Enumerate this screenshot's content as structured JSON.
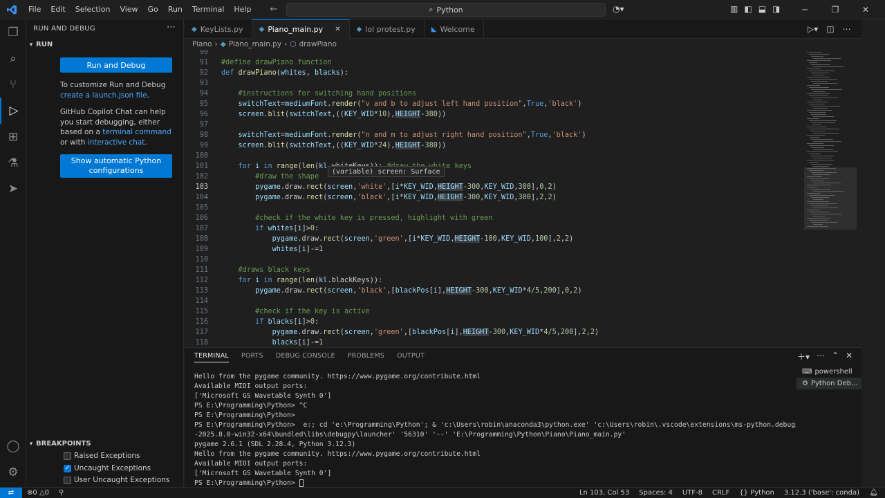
{
  "titlebar": {
    "menu": [
      "File",
      "Edit",
      "Selection",
      "View",
      "Go",
      "Run",
      "Terminal",
      "Help"
    ],
    "search_text": "Python"
  },
  "sidebar": {
    "title": "RUN AND DEBUG",
    "run_section": "RUN",
    "run_debug_button": "Run and Debug",
    "customize_text": "To customize Run and Debug",
    "launch_link": "create a launch.json file",
    "launch_suffix": ".",
    "copilot_text_1": "GitHub Copilot Chat can help you start debugging, either based on a",
    "terminal_link": "terminal command",
    "copilot_text_2": " or with",
    "interactive_link": "interactive chat",
    "copilot_text_3": ".",
    "auto_config_button_line1": "Show automatic Python",
    "auto_config_button_line2": "configurations",
    "breakpoints_section": "BREAKPOINTS",
    "breakpoints": [
      {
        "label": "Raised Exceptions",
        "checked": false
      },
      {
        "label": "Uncaught Exceptions",
        "checked": true
      },
      {
        "label": "User Uncaught Exceptions",
        "checked": false
      }
    ]
  },
  "tabs": [
    {
      "label": "KeyLists.py",
      "active": false
    },
    {
      "label": "Piano_main.py",
      "active": true
    },
    {
      "label": "lol protest.py",
      "active": false
    },
    {
      "label": "Welcome",
      "active": false
    }
  ],
  "breadcrumb": [
    "Piano",
    "Piano_main.py",
    "drawPiano"
  ],
  "editor": {
    "current_line": 103,
    "hover": "(variable) screen: Surface",
    "lines": [
      {
        "n": "90",
        "text": ""
      },
      {
        "n": "91",
        "text": "#define drawPiano function"
      },
      {
        "n": "92",
        "text": "def drawPiano(whites, blacks):"
      },
      {
        "n": "93",
        "text": ""
      },
      {
        "n": "94",
        "text": "    #instructions for switching hand positions"
      },
      {
        "n": "95",
        "text": "    switchText=mediumFont.render(\"v and b to adjust left hand position\",True,'black')"
      },
      {
        "n": "96",
        "text": "    screen.blit(switchText,((KEY_WID*10),HEIGHT-380))"
      },
      {
        "n": "97",
        "text": ""
      },
      {
        "n": "98",
        "text": "    switchText=mediumFont.render(\"n and m to adjust right hand position\",True,'black')"
      },
      {
        "n": "99",
        "text": "    screen.blit(switchText,((KEY_WID*24),HEIGHT-380))"
      },
      {
        "n": "100",
        "text": ""
      },
      {
        "n": "101",
        "text": "    for i in range(len(kl.whiteKeys)): #draw the white keys"
      },
      {
        "n": "102",
        "text": "        #draw the shape"
      },
      {
        "n": "103",
        "text": "        pygame.draw.rect(screen,'white',[i*KEY_WID,HEIGHT-300,KEY_WID,300],0,2)"
      },
      {
        "n": "104",
        "text": "        pygame.draw.rect(screen,'black',[i*KEY_WID,HEIGHT-300,KEY_WID,300],2,2)"
      },
      {
        "n": "105",
        "text": ""
      },
      {
        "n": "106",
        "text": "        #check if the white key is pressed, highlight with green"
      },
      {
        "n": "107",
        "text": "        if whites[i]>0:"
      },
      {
        "n": "108",
        "text": "            pygame.draw.rect(screen,'green',[i*KEY_WID,HEIGHT-100,KEY_WID,100],2,2)"
      },
      {
        "n": "109",
        "text": "            whites[i]-=1"
      },
      {
        "n": "110",
        "text": ""
      },
      {
        "n": "111",
        "text": "    #draws black keys"
      },
      {
        "n": "112",
        "text": "    for i in range(len(kl.blackKeys)):"
      },
      {
        "n": "113",
        "text": "        pygame.draw.rect(screen,'black',[blackPos[i],HEIGHT-300,KEY_WID*4/5,200],0,2)"
      },
      {
        "n": "114",
        "text": ""
      },
      {
        "n": "115",
        "text": "        #check if the key is active"
      },
      {
        "n": "116",
        "text": "        if blacks[i]>0:"
      },
      {
        "n": "117",
        "text": "            pygame.draw.rect(screen,'green',[blackPos[i],HEIGHT-300,KEY_WID*4/5,200],2,2)"
      },
      {
        "n": "118",
        "text": "            blacks[i]-=1"
      }
    ]
  },
  "panel": {
    "tabs": [
      "TERMINAL",
      "PORTS",
      "DEBUG CONSOLE",
      "PROBLEMS",
      "OUTPUT"
    ],
    "terminal_lines": [
      "Hello from the pygame community. https://www.pygame.org/contribute.html",
      "Available MIDI output ports:",
      "['Microsoft GS Wavetable Synth 0']",
      "PS E:\\Programming\\Python> ^C",
      "PS E:\\Programming\\Python>",
      "PS E:\\Programming\\Python>  e:; cd 'e:\\Programming\\Python'; & 'c:\\Users\\robin\\anaconda3\\python.exe' 'c:\\Users\\robin\\.vscode\\extensions\\ms-python.debugpy",
      "-2025.8.0-win32-x64\\bundled\\libs\\debugpy\\launcher' '56310' '--' 'E:\\Programming\\Python\\Piano\\Piano_main.py'",
      "pygame 2.6.1 (SDL 2.28.4, Python 3.12.3)",
      "Hello from the pygame community. https://www.pygame.org/contribute.html",
      "Available MIDI output ports:",
      "['Microsoft GS Wavetable Synth 0']",
      "PS E:\\Programming\\Python> "
    ],
    "terminal_instances": [
      {
        "label": "powershell",
        "active": false
      },
      {
        "label": "Python Deb...",
        "active": true
      }
    ]
  },
  "statusbar": {
    "errors": "0",
    "warnings": "0",
    "position": "Ln 103, Col 53",
    "spaces": "Spaces: 4",
    "encoding": "UTF-8",
    "eol": "CRLF",
    "language": "Python",
    "interpreter": "3.12.3 ('base': conda)"
  },
  "colors": {
    "accent": "#0078d4",
    "editor_bg": "#1f1f1f",
    "sidebar_bg": "#181818"
  }
}
